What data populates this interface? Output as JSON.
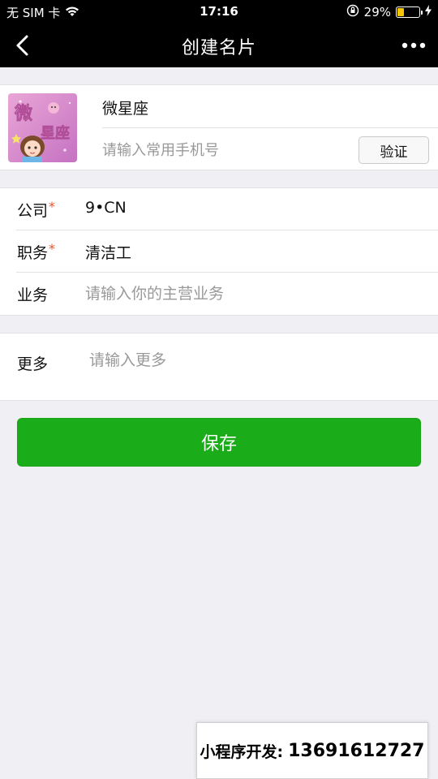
{
  "status_bar": {
    "carrier": "无 SIM 卡",
    "time": "17:16",
    "battery_percent": "29%",
    "battery_level": 0.29,
    "battery_color": "#f5c400"
  },
  "nav": {
    "title": "创建名片",
    "back_icon": "chevron-left-icon",
    "more_icon": "more-dots-icon"
  },
  "profile": {
    "name": "微星座",
    "avatar_text_top": "微",
    "avatar_text_bottom": "星座",
    "phone_placeholder": "请输入常用手机号",
    "phone_value": "",
    "verify_label": "验证"
  },
  "form": {
    "rows": [
      {
        "label": "公司",
        "required": "*",
        "value": "9•CN"
      },
      {
        "label": "职务",
        "required": "*",
        "value": "清洁工"
      },
      {
        "label": "业务",
        "required": "",
        "value": "",
        "placeholder": "请输入你的主营业务"
      }
    ]
  },
  "more": {
    "label": "更多",
    "placeholder": "请输入更多"
  },
  "save_label": "保存",
  "colors": {
    "primary_green": "#1aad19",
    "required_red": "#e8542a",
    "nav_bg": "#000000",
    "page_bg": "#efeff4"
  },
  "watermark": {
    "prefix": "小程序开发:",
    "phone": "13691612727"
  }
}
